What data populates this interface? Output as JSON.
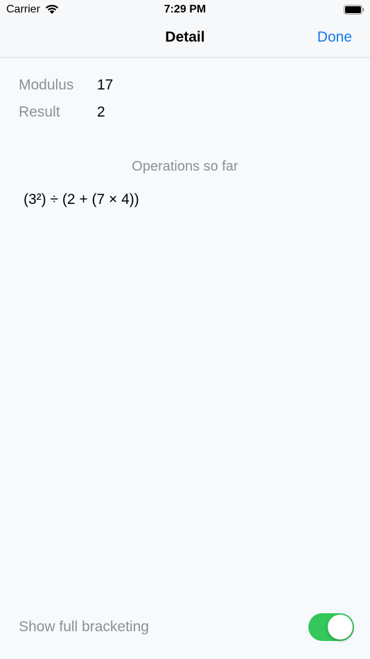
{
  "status_bar": {
    "carrier": "Carrier",
    "time": "7:29 PM",
    "wifi_icon": "wifi-icon",
    "battery_icon": "battery-icon"
  },
  "nav": {
    "title": "Detail",
    "done_label": "Done",
    "accent_color": "#1478e6"
  },
  "info": {
    "modulus_label": "Modulus",
    "modulus_value": "17",
    "result_label": "Result",
    "result_value": "2"
  },
  "operations": {
    "heading": "Operations so far",
    "expression": "(3²) ÷ (2 + (7 × 4))"
  },
  "footer": {
    "toggle_label": "Show full bracketing",
    "toggle_on": true,
    "toggle_color": "#34c759"
  }
}
